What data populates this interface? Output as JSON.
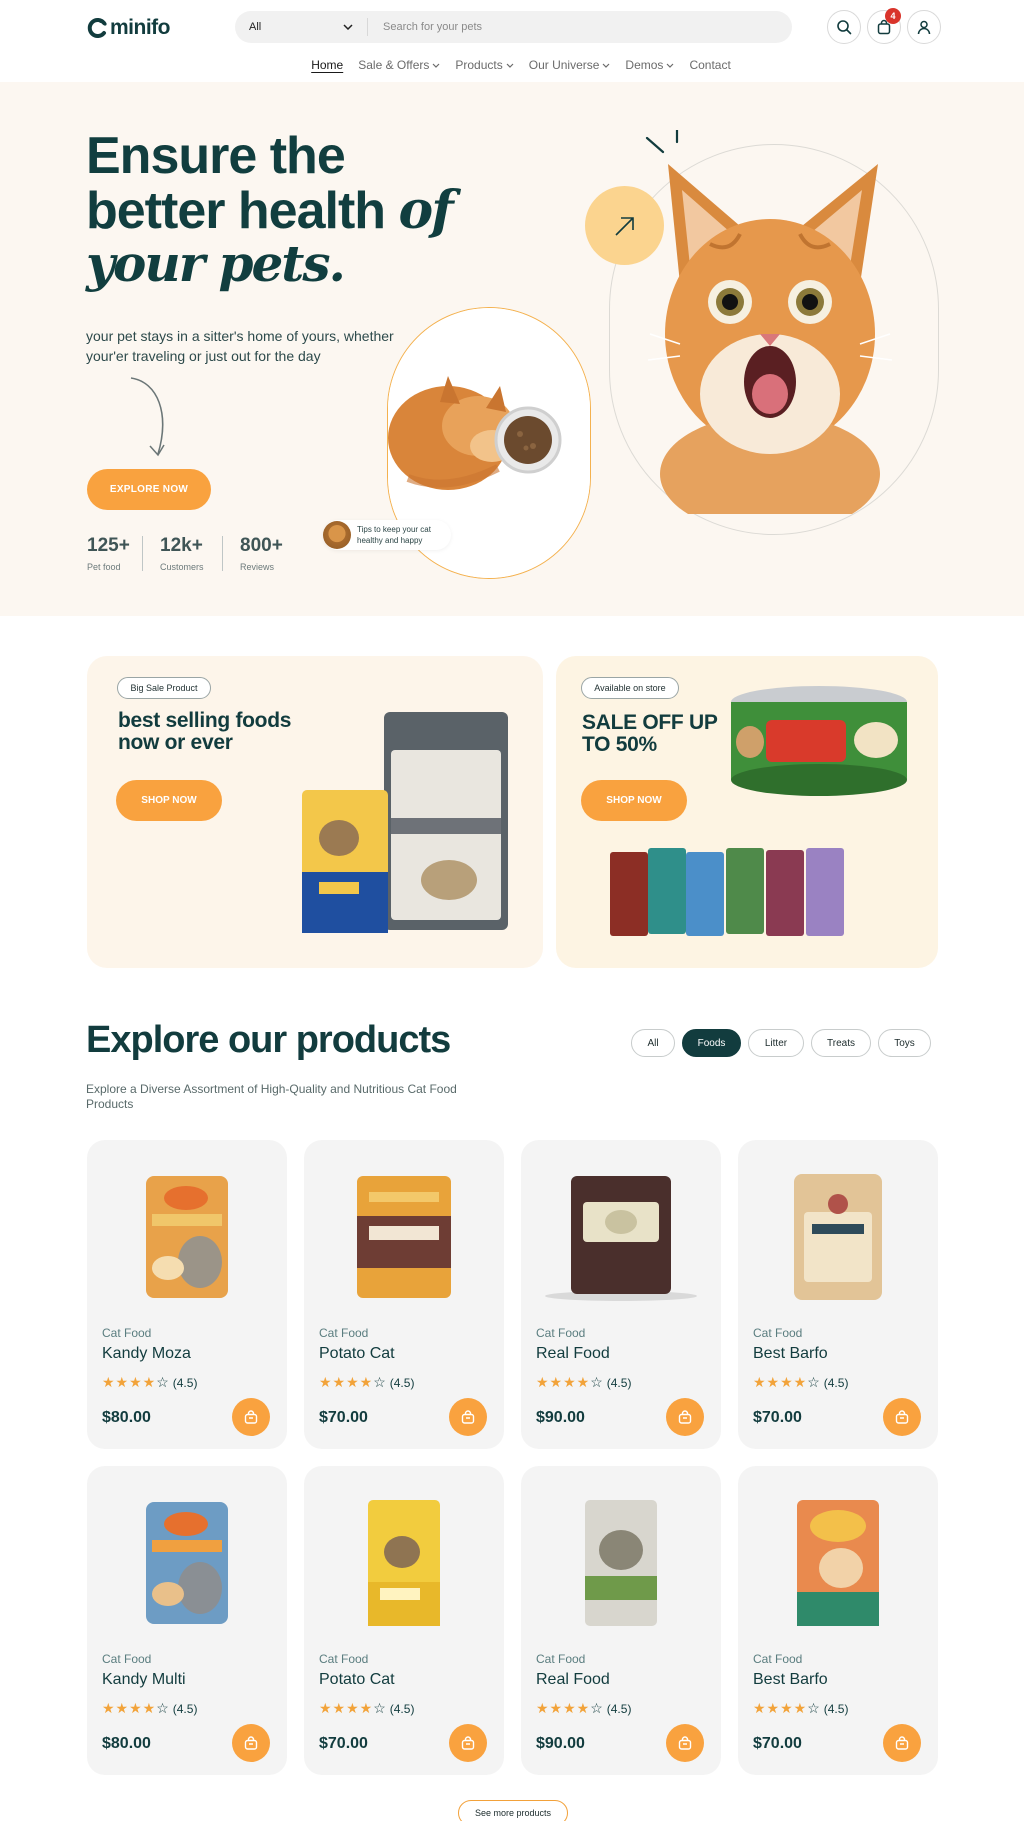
{
  "header": {
    "logo_text": "minifo",
    "search": {
      "category": "All",
      "placeholder": "Search for your pets"
    },
    "cart_count": "4",
    "nav": [
      "Home",
      "Sale & Offers",
      "Products",
      "Our Universe",
      "Demos",
      "Contact"
    ]
  },
  "hero": {
    "title_line1": "Ensure the",
    "title_line2": "better health",
    "title_line2_italic": "of",
    "title_line3": "your pets.",
    "subtitle": "your pet stays in a sitter's home of yours, whether your'er traveling or just out for the day",
    "cta": "EXPLORE NOW",
    "stats": [
      {
        "value": "125+",
        "label": "Pet food"
      },
      {
        "value": "12k+",
        "label": "Customers"
      },
      {
        "value": "800+",
        "label": "Reviews"
      }
    ],
    "tip": "Tips to keep your cat healthy and happy"
  },
  "promo": {
    "left": {
      "tag": "Big Sale Product",
      "title_line1": "best selling foods",
      "title_line2": "now or ever",
      "cta": "SHOP NOW"
    },
    "right": {
      "tag": "Available on store",
      "title_line1": "SALE OFF UP",
      "title_line2": "TO 50%",
      "cta": "SHOP NOW"
    }
  },
  "products_section": {
    "title": "Explore our products",
    "subtitle": "Explore a Diverse Assortment of High-Quality and Nutritious Cat Food Products",
    "filters": [
      "All",
      "Foods",
      "Litter",
      "Treats",
      "Toys"
    ],
    "active_filter": "Foods",
    "products": [
      {
        "category": "Cat Food",
        "name": "Kandy Moza",
        "rating": "(4.5)",
        "price": "$80.00"
      },
      {
        "category": "Cat Food",
        "name": "Potato Cat",
        "rating": "(4.5)",
        "price": "$70.00"
      },
      {
        "category": "Cat Food",
        "name": "Real Food",
        "rating": "(4.5)",
        "price": "$90.00"
      },
      {
        "category": "Cat Food",
        "name": "Best Barfo",
        "rating": "(4.5)",
        "price": "$70.00"
      },
      {
        "category": "Cat Food",
        "name": "Kandy Multi",
        "rating": "(4.5)",
        "price": "$80.00"
      },
      {
        "category": "Cat Food",
        "name": "Potato Cat",
        "rating": "(4.5)",
        "price": "$70.00"
      },
      {
        "category": "Cat Food",
        "name": "Real Food",
        "rating": "(4.5)",
        "price": "$90.00"
      },
      {
        "category": "Cat Food",
        "name": "Best Barfo",
        "rating": "(4.5)",
        "price": "$70.00"
      }
    ],
    "see_more": "See more products"
  },
  "colors": {
    "primary_dark": "#123c3e",
    "accent_orange": "#f9a23f",
    "hero_bg": "#fcf7f1",
    "badge_red": "#d9342b"
  }
}
